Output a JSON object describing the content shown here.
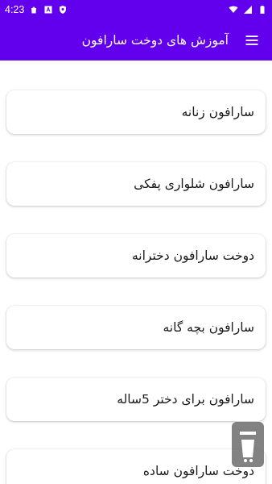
{
  "status_bar": {
    "time": "4:23",
    "left_icons": [
      "shopping-bag-icon",
      "bazaar-icon",
      "shield-icon"
    ],
    "right_icons": [
      "wifi-icon",
      "signal-icon",
      "battery-icon"
    ]
  },
  "app_bar": {
    "title": "آموزش های دوخت سارافون",
    "menu_icon": "menu-icon"
  },
  "list": {
    "items": [
      {
        "label": "سارافون زنانه"
      },
      {
        "label": "سارافون شلواری پفکی"
      },
      {
        "label": "دوخت سارافون دخترانه"
      },
      {
        "label": "سارافون بچه گانه"
      },
      {
        "label": "سارافون برای دختر 5ساله"
      },
      {
        "label": "دوخت سارافون ساده"
      }
    ]
  },
  "colors": {
    "primary": "#6200ee",
    "card_background": "#ffffff",
    "text": "#1a1a1a"
  }
}
